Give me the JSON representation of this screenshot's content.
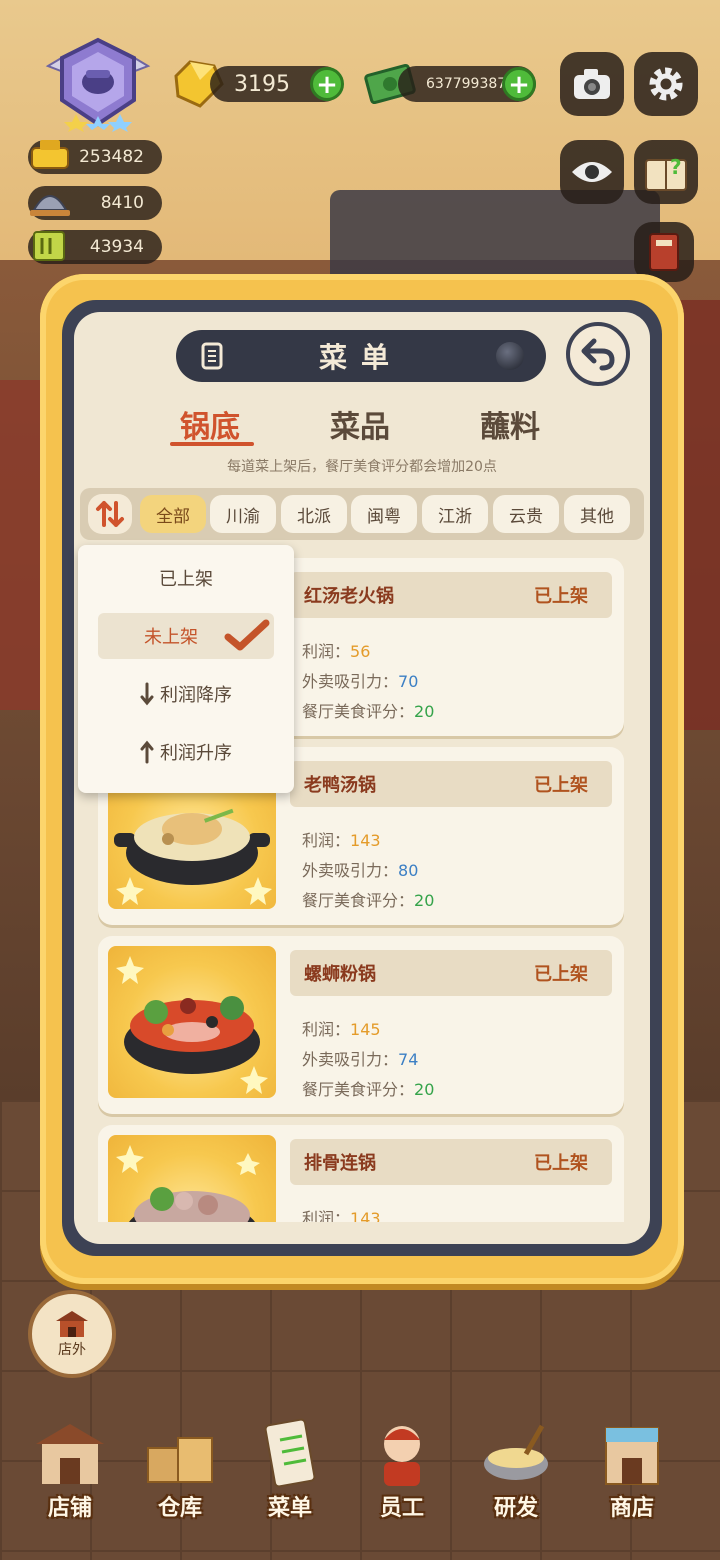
{
  "hud": {
    "gems": "3195",
    "cash": "637799387",
    "stats": [
      "253482",
      "8410",
      "43934"
    ]
  },
  "modal": {
    "title": "菜单",
    "tabs": [
      "锅底",
      "菜品",
      "蘸料"
    ],
    "notice": "每道菜上架后，餐厅美食评分都会增加20点",
    "regions": [
      "全部",
      "川渝",
      "北派",
      "闽粤",
      "江浙",
      "云贵",
      "其他"
    ],
    "dropdown": [
      "已上架",
      "未上架",
      "利润降序",
      "利润升序"
    ],
    "stat_labels": {
      "profit": "利润：",
      "attract": "外卖吸引力：",
      "rating": "餐厅美食评分："
    },
    "dishes": [
      {
        "name": "红汤老火锅",
        "status": "已上架",
        "profit": "56",
        "attract": "70",
        "rating": "20"
      },
      {
        "name": "老鸭汤锅",
        "status": "已上架",
        "profit": "143",
        "attract": "80",
        "rating": "20"
      },
      {
        "name": "螺蛳粉锅",
        "status": "已上架",
        "profit": "145",
        "attract": "74",
        "rating": "20"
      },
      {
        "name": "排骨连锅",
        "status": "已上架",
        "profit": "143"
      }
    ]
  },
  "bottom": {
    "outside": "店外",
    "nav": [
      "店铺",
      "仓库",
      "菜单",
      "员工",
      "研发",
      "商店"
    ]
  },
  "colors": {
    "accent": "#d0532d",
    "gold": "#f5c24e",
    "frame": "#3d4254"
  }
}
